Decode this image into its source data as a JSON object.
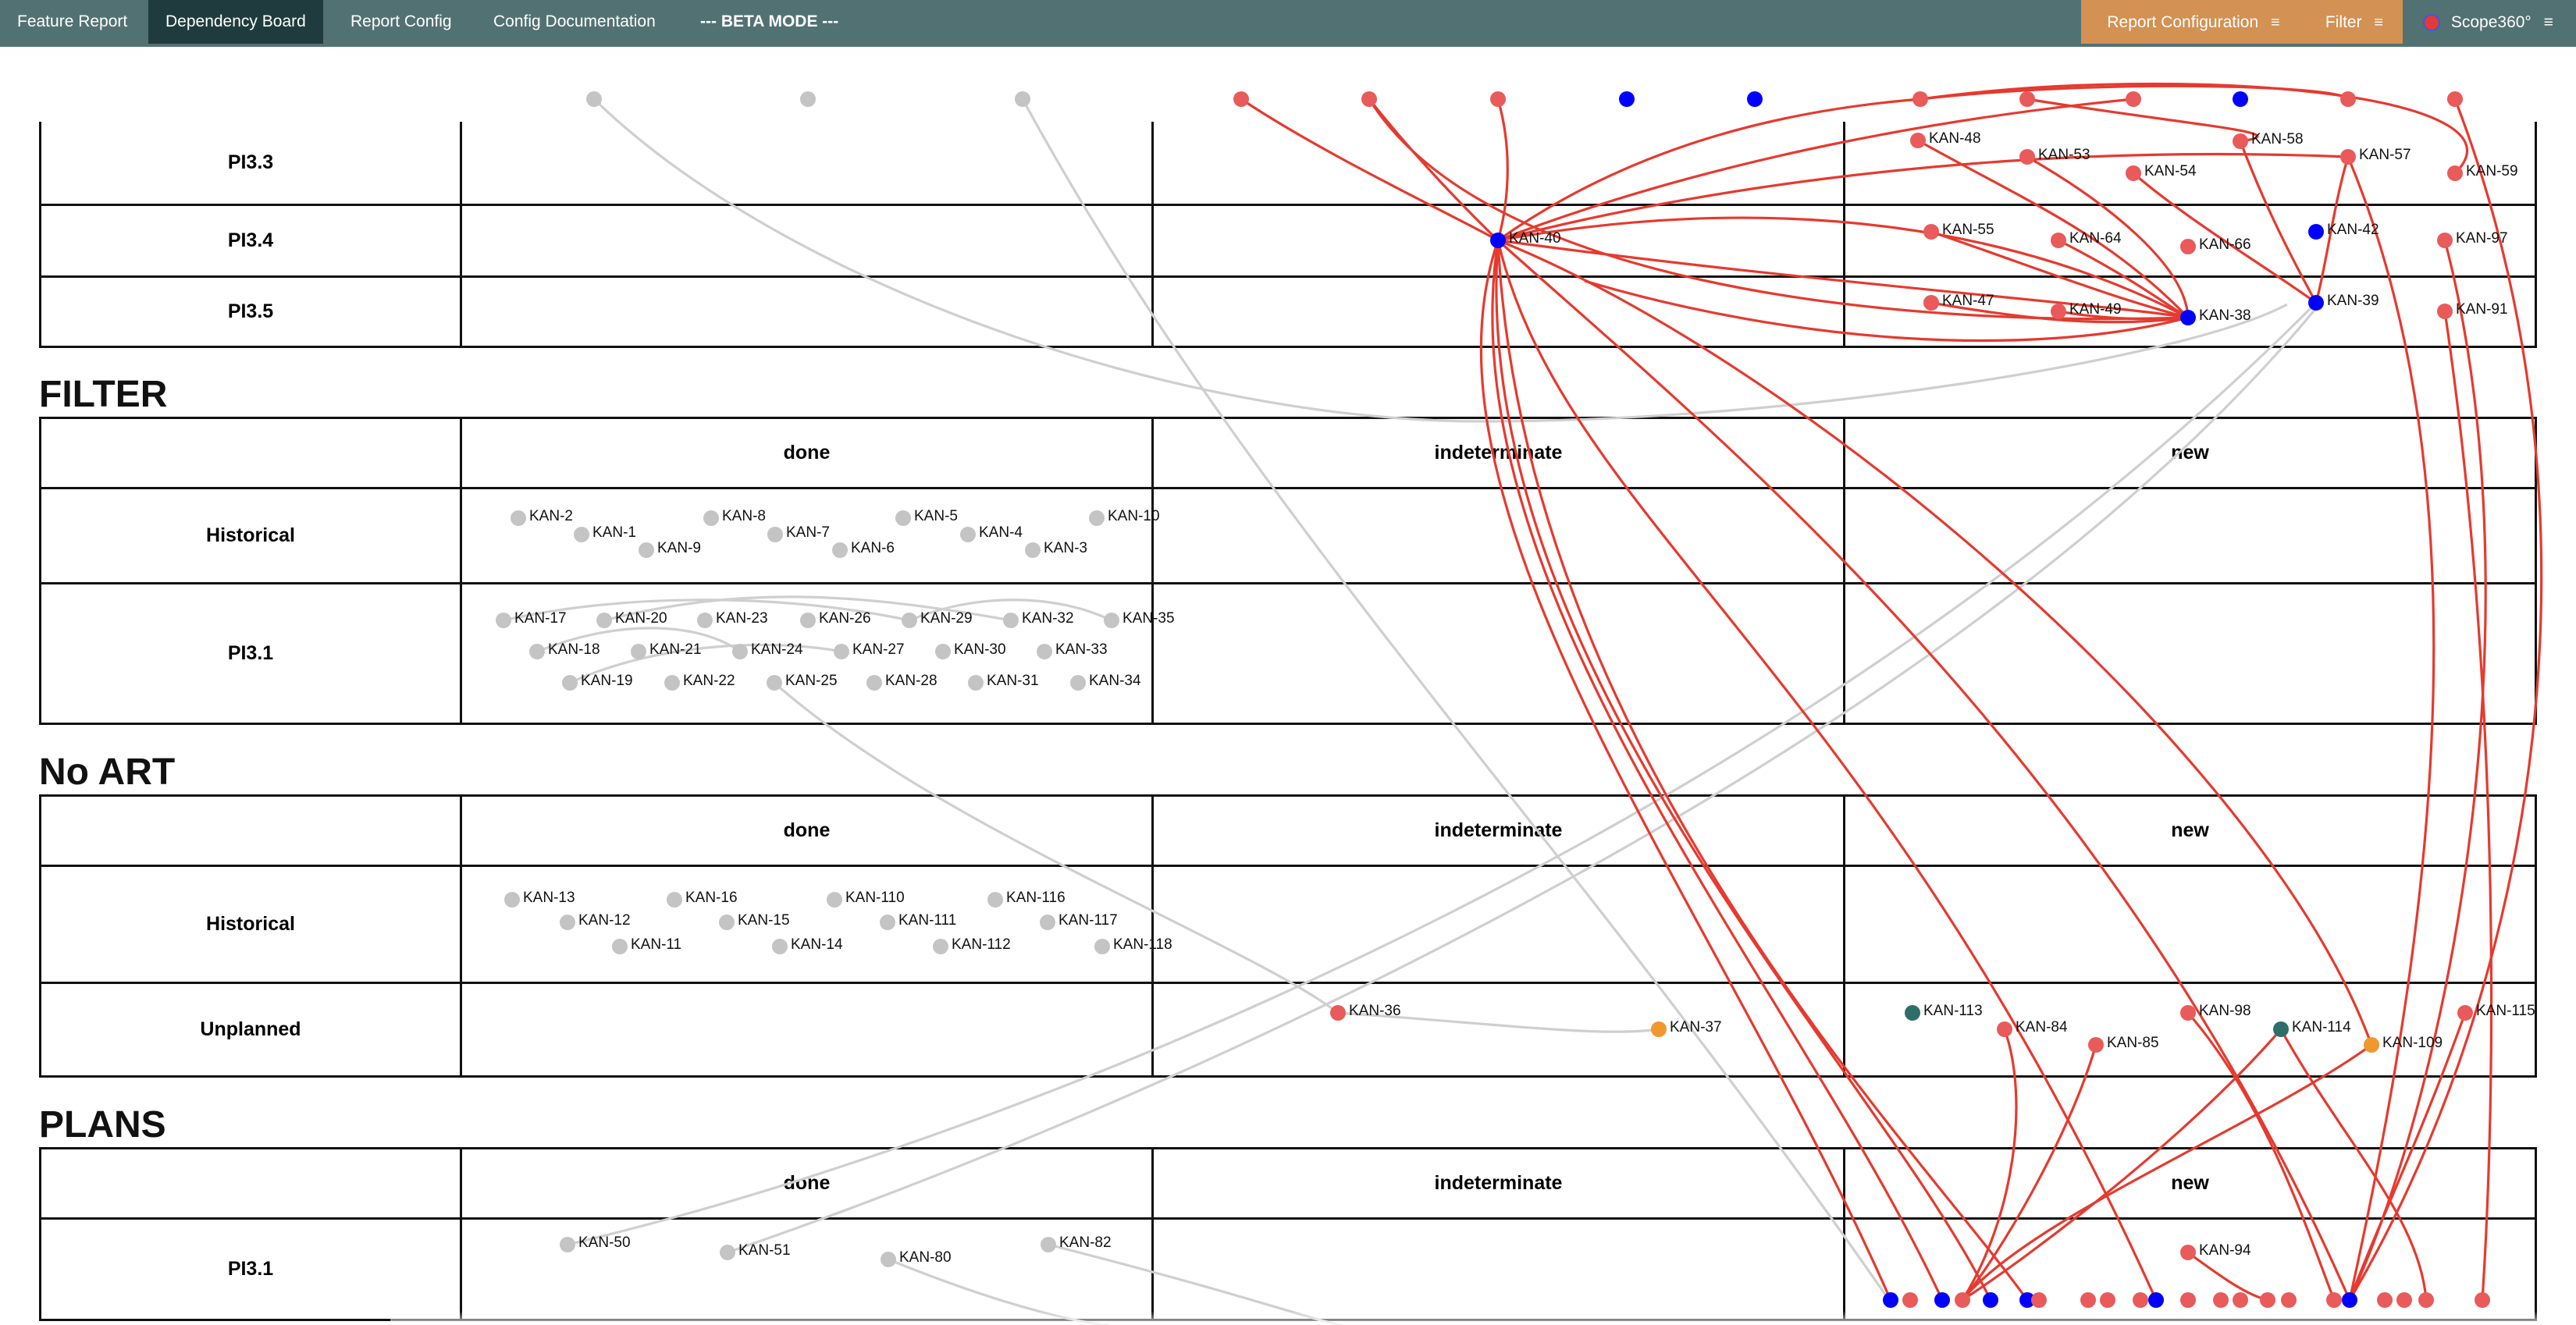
{
  "nav": {
    "tabs": [
      {
        "label": "Feature Report",
        "active": false
      },
      {
        "label": "Dependency Board",
        "active": true
      },
      {
        "label": "Report Config",
        "active": false
      },
      {
        "label": "Config Documentation",
        "active": false
      }
    ],
    "beta_label": "--- BETA MODE ---",
    "report_configuration": "Report Configuration",
    "filter": "Filter",
    "brand": "Scope360°",
    "menu_icon": "hamburger-icon"
  },
  "colors": {
    "topbar": "#527173",
    "active_tab": "#1f3b3d",
    "accent_button": "#d39153",
    "node_grey": "#c4c4c4",
    "node_red": "#e95a5a",
    "node_blue": "#0000ff",
    "node_teal": "#2f6d6a",
    "node_orange": "#f0972e",
    "link_red": "#e53a2f",
    "link_grey": "#cfcfcf"
  },
  "sections": [
    {
      "id": "top",
      "title": "",
      "columns": [],
      "rows": [
        "PI3.3",
        "PI3.4",
        "PI3.5"
      ]
    },
    {
      "id": "filter",
      "title": "FILTER",
      "columns": [
        "done",
        "indeterminate",
        "new"
      ],
      "rows": [
        "Historical",
        "PI3.1"
      ]
    },
    {
      "id": "noart",
      "title": "No ART",
      "columns": [
        "done",
        "indeterminate",
        "new"
      ],
      "rows": [
        "Historical",
        "Unplanned"
      ]
    },
    {
      "id": "plans",
      "title": "PLANS",
      "columns": [
        "done",
        "indeterminate",
        "new"
      ],
      "rows": [
        "PI3.1"
      ]
    }
  ],
  "nodes": [
    {
      "id": "KAN-48",
      "label": "KAN-48",
      "color": "red"
    },
    {
      "id": "KAN-53",
      "label": "KAN-53",
      "color": "red"
    },
    {
      "id": "KAN-54",
      "label": "KAN-54",
      "color": "red"
    },
    {
      "id": "KAN-58",
      "label": "KAN-58",
      "color": "red"
    },
    {
      "id": "KAN-57",
      "label": "KAN-57",
      "color": "red"
    },
    {
      "id": "KAN-59",
      "label": "KAN-59",
      "color": "red"
    },
    {
      "id": "KAN-40",
      "label": "KAN-40",
      "color": "blue"
    },
    {
      "id": "KAN-55",
      "label": "KAN-55",
      "color": "red"
    },
    {
      "id": "KAN-64",
      "label": "KAN-64",
      "color": "red"
    },
    {
      "id": "KAN-66",
      "label": "KAN-66",
      "color": "red"
    },
    {
      "id": "KAN-42",
      "label": "KAN-42",
      "color": "blue"
    },
    {
      "id": "KAN-97",
      "label": "KAN-97",
      "color": "red"
    },
    {
      "id": "KAN-47",
      "label": "KAN-47",
      "color": "red"
    },
    {
      "id": "KAN-49",
      "label": "KAN-49",
      "color": "red"
    },
    {
      "id": "KAN-38",
      "label": "KAN-38",
      "color": "blue"
    },
    {
      "id": "KAN-39",
      "label": "KAN-39",
      "color": "blue"
    },
    {
      "id": "KAN-91",
      "label": "KAN-91",
      "color": "red"
    },
    {
      "id": "KAN-2",
      "label": "KAN-2",
      "color": "grey"
    },
    {
      "id": "KAN-1",
      "label": "KAN-1",
      "color": "grey"
    },
    {
      "id": "KAN-9",
      "label": "KAN-9",
      "color": "grey"
    },
    {
      "id": "KAN-8",
      "label": "KAN-8",
      "color": "grey"
    },
    {
      "id": "KAN-7",
      "label": "KAN-7",
      "color": "grey"
    },
    {
      "id": "KAN-6",
      "label": "KAN-6",
      "color": "grey"
    },
    {
      "id": "KAN-5",
      "label": "KAN-5",
      "color": "grey"
    },
    {
      "id": "KAN-4",
      "label": "KAN-4",
      "color": "grey"
    },
    {
      "id": "KAN-3",
      "label": "KAN-3",
      "color": "grey"
    },
    {
      "id": "KAN-10",
      "label": "KAN-10",
      "color": "grey"
    },
    {
      "id": "KAN-17",
      "label": "KAN-17",
      "color": "grey"
    },
    {
      "id": "KAN-20",
      "label": "KAN-20",
      "color": "grey"
    },
    {
      "id": "KAN-23",
      "label": "KAN-23",
      "color": "grey"
    },
    {
      "id": "KAN-26",
      "label": "KAN-26",
      "color": "grey"
    },
    {
      "id": "KAN-29",
      "label": "KAN-29",
      "color": "grey"
    },
    {
      "id": "KAN-32",
      "label": "KAN-32",
      "color": "grey"
    },
    {
      "id": "KAN-35",
      "label": "KAN-35",
      "color": "grey"
    },
    {
      "id": "KAN-18",
      "label": "KAN-18",
      "color": "grey"
    },
    {
      "id": "KAN-21",
      "label": "KAN-21",
      "color": "grey"
    },
    {
      "id": "KAN-24",
      "label": "KAN-24",
      "color": "grey"
    },
    {
      "id": "KAN-27",
      "label": "KAN-27",
      "color": "grey"
    },
    {
      "id": "KAN-30",
      "label": "KAN-30",
      "color": "grey"
    },
    {
      "id": "KAN-33",
      "label": "KAN-33",
      "color": "grey"
    },
    {
      "id": "KAN-19",
      "label": "KAN-19",
      "color": "grey"
    },
    {
      "id": "KAN-22",
      "label": "KAN-22",
      "color": "grey"
    },
    {
      "id": "KAN-25",
      "label": "KAN-25",
      "color": "grey"
    },
    {
      "id": "KAN-28",
      "label": "KAN-28",
      "color": "grey"
    },
    {
      "id": "KAN-31",
      "label": "KAN-31",
      "color": "grey"
    },
    {
      "id": "KAN-34",
      "label": "KAN-34",
      "color": "grey"
    },
    {
      "id": "KAN-13",
      "label": "KAN-13",
      "color": "grey"
    },
    {
      "id": "KAN-16",
      "label": "KAN-16",
      "color": "grey"
    },
    {
      "id": "KAN-110",
      "label": "KAN-110",
      "color": "grey"
    },
    {
      "id": "KAN-116",
      "label": "KAN-116",
      "color": "grey"
    },
    {
      "id": "KAN-12",
      "label": "KAN-12",
      "color": "grey"
    },
    {
      "id": "KAN-15",
      "label": "KAN-15",
      "color": "grey"
    },
    {
      "id": "KAN-111",
      "label": "KAN-111",
      "color": "grey"
    },
    {
      "id": "KAN-117",
      "label": "KAN-117",
      "color": "grey"
    },
    {
      "id": "KAN-11",
      "label": "KAN-11",
      "color": "grey"
    },
    {
      "id": "KAN-14",
      "label": "KAN-14",
      "color": "grey"
    },
    {
      "id": "KAN-112",
      "label": "KAN-112",
      "color": "grey"
    },
    {
      "id": "KAN-118",
      "label": "KAN-118",
      "color": "grey"
    },
    {
      "id": "KAN-36",
      "label": "KAN-36",
      "color": "red"
    },
    {
      "id": "KAN-37",
      "label": "KAN-37",
      "color": "orange"
    },
    {
      "id": "KAN-113",
      "label": "KAN-113",
      "color": "teal"
    },
    {
      "id": "KAN-84",
      "label": "KAN-84",
      "color": "red"
    },
    {
      "id": "KAN-85",
      "label": "KAN-85",
      "color": "red"
    },
    {
      "id": "KAN-98",
      "label": "KAN-98",
      "color": "red"
    },
    {
      "id": "KAN-114",
      "label": "KAN-114",
      "color": "teal"
    },
    {
      "id": "KAN-109",
      "label": "KAN-109",
      "color": "orange"
    },
    {
      "id": "KAN-115",
      "label": "KAN-115",
      "color": "red"
    },
    {
      "id": "KAN-50",
      "label": "KAN-50",
      "color": "grey"
    },
    {
      "id": "KAN-51",
      "label": "KAN-51",
      "color": "grey"
    },
    {
      "id": "KAN-80",
      "label": "KAN-80",
      "color": "grey"
    },
    {
      "id": "KAN-82",
      "label": "KAN-82",
      "color": "grey"
    },
    {
      "id": "KAN-94",
      "label": "KAN-94",
      "color": "red"
    }
  ]
}
